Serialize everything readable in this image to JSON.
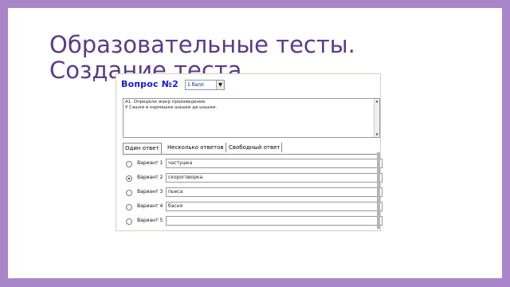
{
  "slide": {
    "title_line1": "Образовательные тесты.",
    "title_line2": "Создание теста"
  },
  "editor": {
    "question_title": "Вопрос №2",
    "points_value": "1 балл",
    "question_lines": [
      "А1. Определи жанр произведения.",
      "У Сашки в кармашке шашки да шашки."
    ],
    "tabs": [
      {
        "label": "Один ответ",
        "active": true
      },
      {
        "label": "Несколько ответов",
        "active": false
      },
      {
        "label": "Свободный ответ",
        "active": false
      }
    ],
    "options": [
      {
        "label": "Вариант 1",
        "value": "частушка",
        "checked": false
      },
      {
        "label": "Вариант 2",
        "value": "скороговорка",
        "checked": true
      },
      {
        "label": "Вариант 3",
        "value": "пьеса",
        "checked": false
      },
      {
        "label": "Вариант 4",
        "value": "басня",
        "checked": false
      },
      {
        "label": "Вариант 5",
        "value": "",
        "checked": false
      }
    ]
  },
  "colors": {
    "frame": "#a986c9",
    "title": "#5b3b86",
    "question_title": "#1a1ad8"
  },
  "icons": [
    "dropdown-arrow-icon",
    "scroll-up-icon",
    "scroll-down-icon",
    "radio-icon"
  ]
}
